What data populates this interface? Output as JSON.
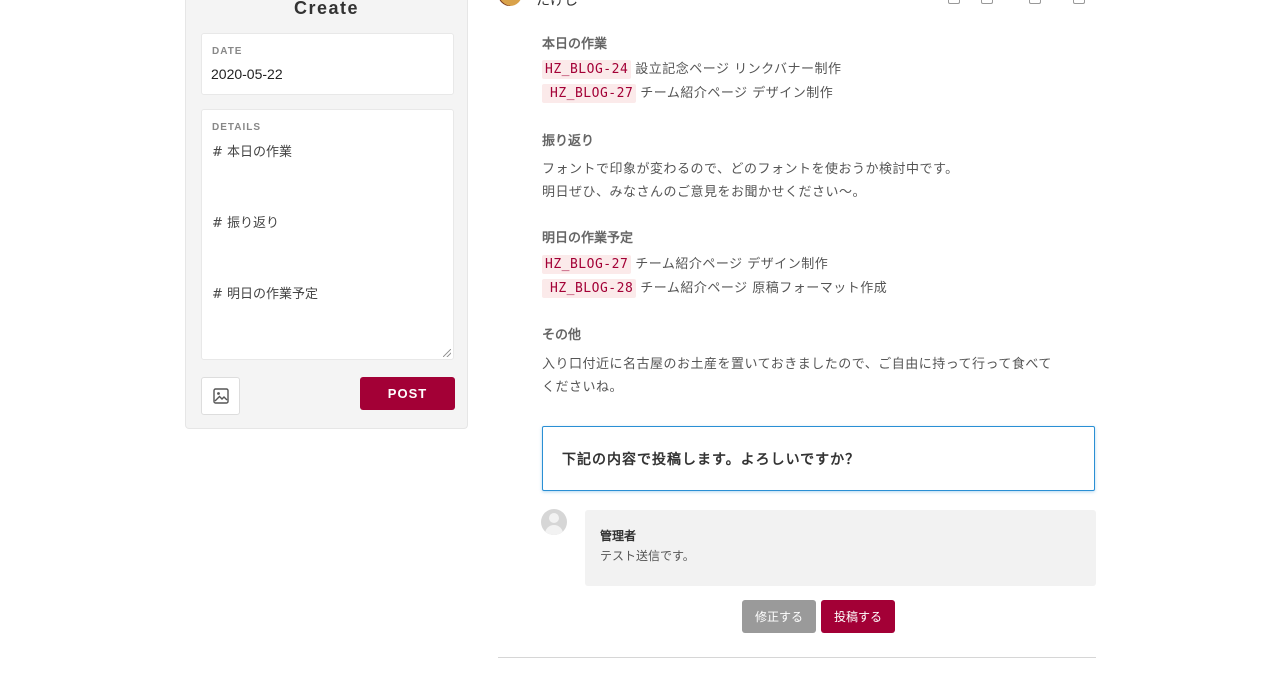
{
  "create_panel": {
    "title": "Create",
    "date_label": "DATE",
    "date_value": "2020-05-22",
    "details_label": "DETAILS",
    "details_lines": [
      "# 本日の作業",
      "# 振り返り",
      "# 明日の作業予定"
    ],
    "image_icon": "image-icon",
    "post_label": "POST"
  },
  "preview": {
    "author_partial": "たけし",
    "sections": [
      {
        "title": "本日の作業",
        "rows": [
          {
            "tag": "HZ_BLOG-24",
            "text": "設立記念ページ リンクバナー制作"
          },
          {
            "tag": "HZ_BLOG-27",
            "text": "チーム紹介ページ デザイン制作"
          }
        ]
      },
      {
        "title": "振り返り",
        "lines": [
          "フォントで印象が変わるので、どのフォントを使おうか検討中です。",
          "明日ぜひ、みなさんのご意見をお聞かせください〜。"
        ]
      },
      {
        "title": "明日の作業予定",
        "rows": [
          {
            "tag": "HZ_BLOG-27",
            "text": "チーム紹介ページ デザイン制作"
          },
          {
            "tag": "HZ_BLOG-28",
            "text": "チーム紹介ページ 原稿フォーマット作成"
          }
        ]
      },
      {
        "title": "その他",
        "lines": [
          "入り口付近に名古屋のお土産を置いておきましたので、ご自由に持って行って食べて",
          "くださいね。"
        ]
      }
    ],
    "confirm_text": "下記の内容で投稿します。よろしいですか？",
    "comment": {
      "author": "管理者",
      "body": "テスト送信です。"
    },
    "edit_label": "修正する",
    "submit_label": "投稿する"
  },
  "colors": {
    "accent": "#a30036",
    "tag_bg": "#fbeaea",
    "confirm_border": "#2a8fd4",
    "edit_button": "#9a9a9a"
  }
}
